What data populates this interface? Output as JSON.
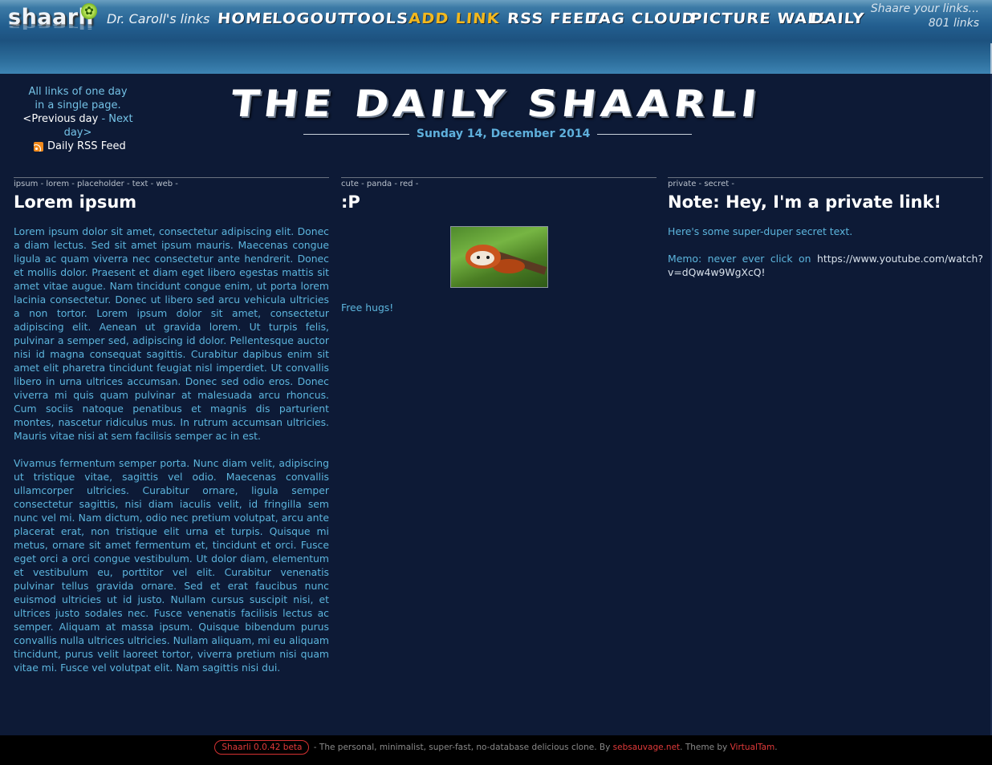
{
  "header": {
    "logo": "shaarli",
    "site_title": "Dr. Caroll's links",
    "nav": [
      {
        "label": "Home"
      },
      {
        "label": "Logout"
      },
      {
        "label": "Tools"
      },
      {
        "label": "Add link",
        "active": true
      },
      {
        "label": "RSS Feed"
      },
      {
        "label": "Tag cloud"
      },
      {
        "label": "Picture wall"
      },
      {
        "label": "Daily"
      }
    ],
    "tagline": "Shaare your links...",
    "link_count": "801 links"
  },
  "daily": {
    "nav_line1": "All links of one day",
    "nav_line2": "in a single page.",
    "prev_arrow": "<",
    "prev": "Previous day",
    "separator": " - ",
    "next": "Next day",
    "next_arrow": ">",
    "rss": "Daily RSS Feed",
    "title": "The Daily Shaarli",
    "date": "Sunday 14, December 2014"
  },
  "links": [
    {
      "tags": "ipsum - lorem - placeholder - text - web -",
      "title": "Lorem ipsum",
      "paragraphs": [
        "Lorem ipsum dolor sit amet, consectetur adipiscing elit. Donec a diam lectus. Sed sit amet ipsum mauris. Maecenas congue ligula ac quam viverra nec consectetur ante hendrerit. Donec et mollis dolor. Praesent et diam eget libero egestas mattis sit amet vitae augue. Nam tincidunt congue enim, ut porta lorem lacinia consectetur. Donec ut libero sed arcu vehicula ultricies a non tortor. Lorem ipsum dolor sit amet, consectetur adipiscing elit. Aenean ut gravida lorem. Ut turpis felis, pulvinar a semper sed, adipiscing id dolor. Pellentesque auctor nisi id magna consequat sagittis. Curabitur dapibus enim sit amet elit pharetra tincidunt feugiat nisl imperdiet. Ut convallis libero in urna ultrices accumsan. Donec sed odio eros. Donec viverra mi quis quam pulvinar at malesuada arcu rhoncus. Cum sociis natoque penatibus et magnis dis parturient montes, nascetur ridiculus mus. In rutrum accumsan ultricies. Mauris vitae nisi at sem facilisis semper ac in est.",
        "Vivamus fermentum semper porta. Nunc diam velit, adipiscing ut tristique vitae, sagittis vel odio. Maecenas convallis ullamcorper ultricies. Curabitur ornare, ligula semper consectetur sagittis, nisi diam iaculis velit, id fringilla sem nunc vel mi. Nam dictum, odio nec pretium volutpat, arcu ante placerat erat, non tristique elit urna et turpis. Quisque mi metus, ornare sit amet fermentum et, tincidunt et orci. Fusce eget orci a orci congue vestibulum. Ut dolor diam, elementum et vestibulum eu, porttitor vel elit. Curabitur venenatis pulvinar tellus gravida ornare. Sed et erat faucibus nunc euismod ultricies ut id justo. Nullam cursus suscipit nisi, et ultrices justo sodales nec. Fusce venenatis facilisis lectus ac semper. Aliquam at massa ipsum. Quisque bibendum purus convallis nulla ultrices ultricies. Nullam aliquam, mi eu aliquam tincidunt, purus velit laoreet tortor, viverra pretium nisi quam vitae mi. Fusce vel volutpat elit. Nam sagittis nisi dui."
      ]
    },
    {
      "tags": "cute - panda - red -",
      "title": ":P",
      "description": "Free hugs!"
    },
    {
      "tags": "private - secret -",
      "title": "Note: Hey, I'm a private link!",
      "description": "Here's some super-duper secret text.",
      "memo_label": "Memo: never ever click on",
      "memo_url": "https://www.youtube.com/watch?v=dQw4w9WgXcQ!"
    }
  ],
  "footer": {
    "version": "Shaarli 0.0.42 beta",
    "text": " - The personal, minimalist, super-fast, no-database delicious clone. By ",
    "author": "sebsauvage.net",
    "theme_text": ". Theme by ",
    "theme_author": "VirtualTam",
    "end": "."
  },
  "colors": {
    "background": "#0d1a36",
    "header": "#225e8f",
    "link_text": "#5cb5dd",
    "active_nav": "#f2b81e",
    "footer_red": "#e03a3a"
  }
}
